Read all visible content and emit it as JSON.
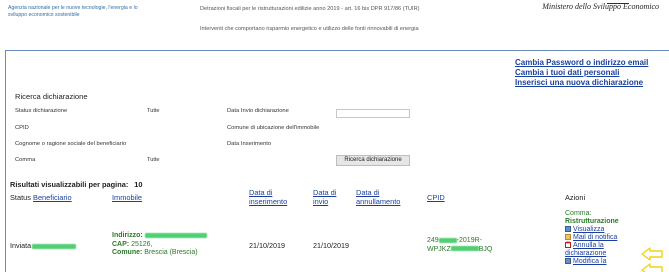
{
  "header": {
    "agency": "Agenzia nazionale per le nuove tecnologie, l'energia e lo sviluppo economico sostenibile",
    "title": "Detrazioni fiscali per le ristrutturazioni edilizie anno 2019 - art. 16 bis DPR 917/86 (TUIR)",
    "subtitle": "Interventi che comportano risparmio energetico e utilizzo delle fonti rinnovabili di energia",
    "ministry": "Ministero dello Sviluppo Economico"
  },
  "links": {
    "password": "Cambia Password o indirizzo email",
    "personal": "Cambia i tuoi dati personali",
    "new_declaration": "Inserisci una nuova dichiarazione"
  },
  "search": {
    "title": "Ricerca dichiarazione",
    "status_label": "Status dichiarazione",
    "status_value": "Tutte",
    "cpid_label": "CPID",
    "beneficiary_label": "Cognome o ragione sociale del beneficiario",
    "comma_label": "Comma",
    "comma_value": "Tutte",
    "sent_date_label": "Data Invio dichiarazione",
    "municipality_label": "Comune di ubicazione dell'immobile",
    "insert_date_label": "Data Inserimento",
    "button": "Ricerca dichiarazione"
  },
  "results": {
    "per_page_label": "Risultati visualizzabili per pagina:",
    "per_page_value": "10",
    "headers": {
      "status": "Status",
      "beneficiary": "Beneficiario",
      "property": "Immobile",
      "insert_date": "Data di inserimento",
      "sent_date": "Data di invio",
      "cancel_date": "Data di annullamento",
      "cpid": "CPID",
      "actions": "Azioni"
    },
    "row": {
      "status": "Inviata",
      "address_label": "Indirizzo:",
      "cap_label": "CAP:",
      "cap_value": "25126,",
      "comune_label": "Comune:",
      "comune_value": "Brescia (Brescia)",
      "insert_date": "21/10/2019",
      "sent_date": "21/10/2019",
      "cpid_part1": "249",
      "cpid_part2": "-2019R-",
      "cpid_part3": "WPJKZ",
      "cpid_part4": "BJQ",
      "comma_label": "Comma:",
      "comma_value": "Ristrutturazione",
      "actions": {
        "view": "Visualizza",
        "mail": "Mail di notifica",
        "cancel": "Annulla la dichiarazione",
        "edit": "Modifica la"
      }
    }
  },
  "colors": {
    "link": "#1a3fa0",
    "highlight_arrow": "#f2d21a",
    "accent_green": "#2a7a2a",
    "panel_border": "#6c8cbf"
  }
}
